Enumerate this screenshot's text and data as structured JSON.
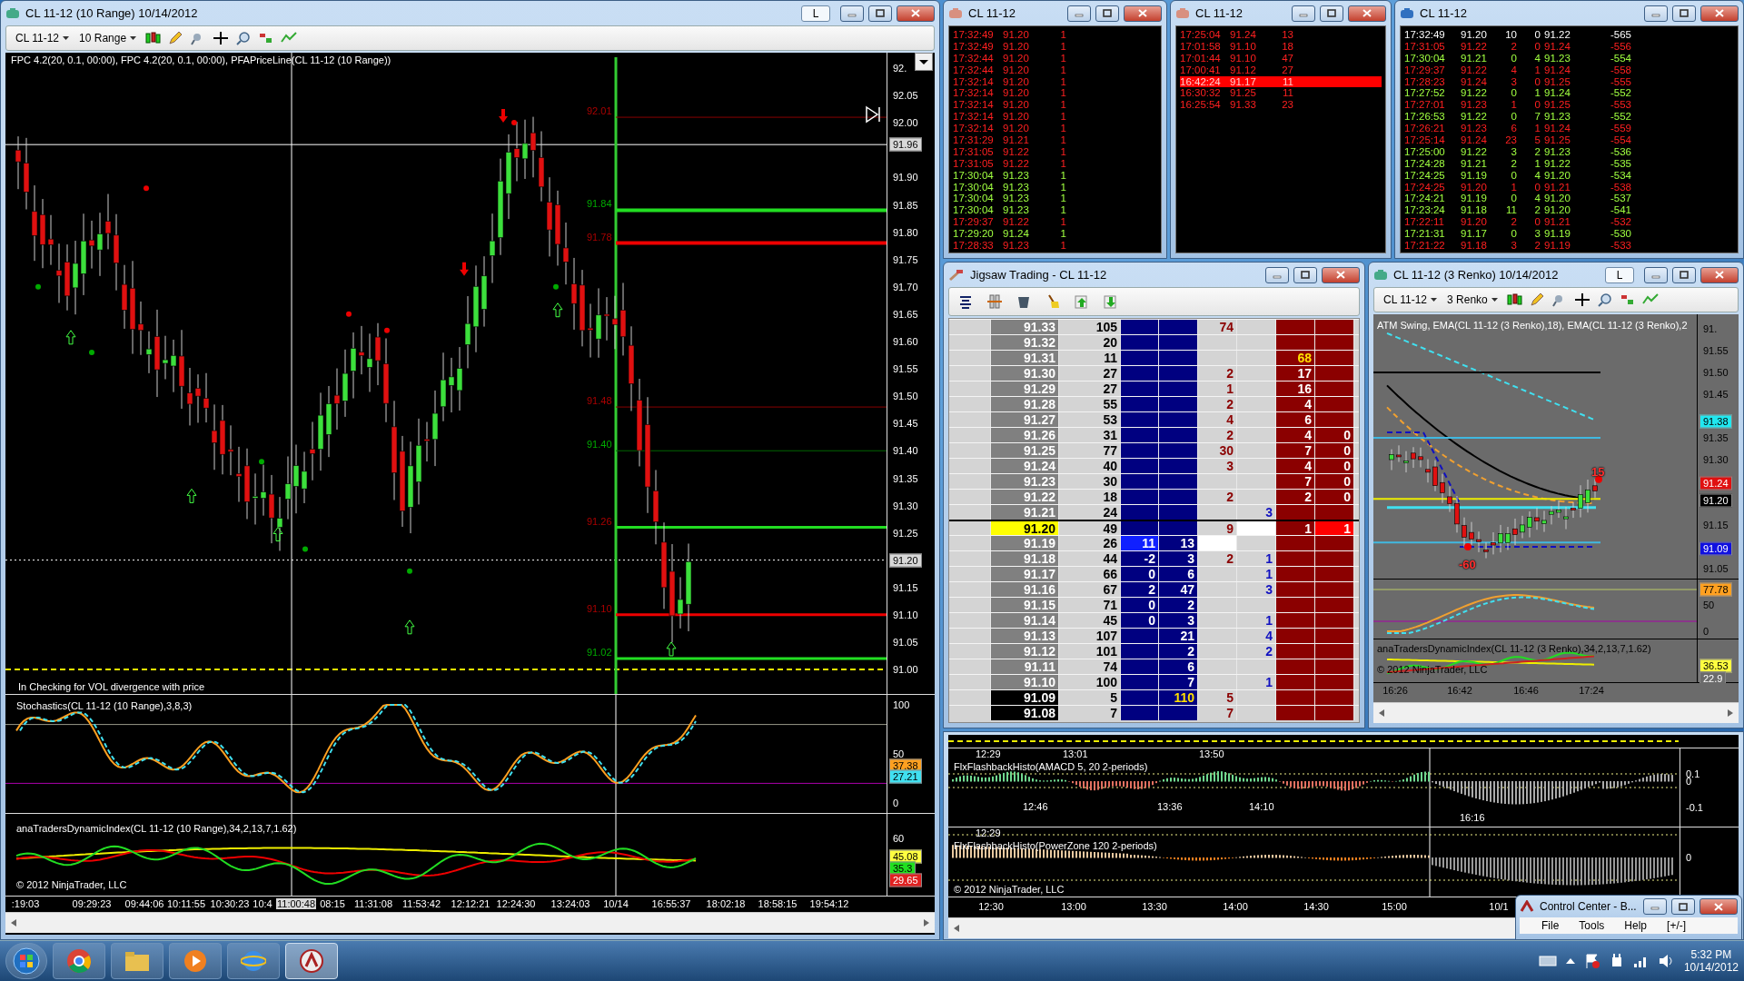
{
  "main_chart": {
    "title": "CL 11-12 (10 Range)  10/14/2012",
    "lock_label": "L",
    "instrument": "CL 11-12",
    "period": "10 Range",
    "indicator_line": "FPC 4.2(20, 0.1, 00:00), FPC 4.2(20, 0.1, 00:00), PFAPriceLine(CL 11-12 (10 Range))",
    "price_axis": [
      "92.",
      "92.05",
      "92.00",
      "91.90",
      "91.85",
      "91.80",
      "91.75",
      "91.70",
      "91.65",
      "91.60",
      "91.55",
      "91.50",
      "91.45",
      "91.40",
      "91.35",
      "91.30",
      "91.25",
      "91.15",
      "91.10",
      "91.05",
      "91.00"
    ],
    "price_badges": [
      {
        "text": "91.96",
        "color": "#d8d8d8"
      },
      {
        "text": "91.20",
        "color": "#d8d8d8"
      }
    ],
    "level_labels": [
      "92.01",
      "91.84",
      "91.78",
      "91.48",
      "91.40",
      "91.26",
      "91.10",
      "91.02"
    ],
    "note": "In  Checking for VOL  divergence with price",
    "stochastics": {
      "title": "Stochastics(CL 11-12 (10 Range),3,8,3)",
      "axis": [
        "100",
        "50",
        "0"
      ],
      "badges": [
        {
          "text": "37.38",
          "color": "#ffa020"
        },
        {
          "text": "27.21",
          "color": "#40e0f0"
        }
      ]
    },
    "dynamic_index": {
      "title": "anaTradersDynamicIndex(CL 11-12 (10 Range),34,2,13,7,1.62)",
      "axis": [
        "60"
      ],
      "badges": [
        {
          "text": "45.08",
          "color": "#ffff40"
        },
        {
          "text": "35.3",
          "color": "#20e020"
        },
        {
          "text": "29.65",
          "color": "#e02020"
        }
      ]
    },
    "copyright": "© 2012 NinjaTrader, LLC",
    "time_axis": [
      {
        "label": ":19:03",
        "kind": "tick"
      },
      {
        "label": "09:29:23",
        "kind": "tick"
      },
      {
        "label": "09:44:06",
        "kind": "tick"
      },
      {
        "label": "10:11:55",
        "kind": "tick"
      },
      {
        "label": "10:30:23",
        "kind": "tick"
      },
      {
        "label": "10:4",
        "kind": "tick"
      },
      {
        "label": "11:00:48",
        "kind": "cursor"
      },
      {
        "label": "08:15",
        "kind": "tick"
      },
      {
        "label": "11:31:08",
        "kind": "tick"
      },
      {
        "label": "11:53:42",
        "kind": "tick"
      },
      {
        "label": "12:12:21",
        "kind": "tick"
      },
      {
        "label": "12:24:30",
        "kind": "tick"
      },
      {
        "label": "13:24:03",
        "kind": "tick"
      },
      {
        "label": "10/14",
        "kind": "tick"
      },
      {
        "label": "16:55:37",
        "kind": "tick"
      },
      {
        "label": "18:02:18",
        "kind": "tick"
      },
      {
        "label": "18:58:15",
        "kind": "tick"
      },
      {
        "label": "19:54:12",
        "kind": "tick"
      }
    ]
  },
  "time_sales": [
    {
      "title": "CL 11-12",
      "rows": [
        {
          "cells": [
            "17:32:49",
            "91.20",
            "1"
          ],
          "kind": "sell"
        },
        {
          "cells": [
            "17:32:49",
            "91.20",
            "1"
          ],
          "kind": "sell"
        },
        {
          "cells": [
            "17:32:44",
            "91.20",
            "1"
          ],
          "kind": "sell"
        },
        {
          "cells": [
            "17:32:44",
            "91.20",
            "1"
          ],
          "kind": "sell"
        },
        {
          "cells": [
            "17:32:14",
            "91.20",
            "1"
          ],
          "kind": "sell"
        },
        {
          "cells": [
            "17:32:14",
            "91.20",
            "1"
          ],
          "kind": "sell"
        },
        {
          "cells": [
            "17:32:14",
            "91.20",
            "1"
          ],
          "kind": "sell"
        },
        {
          "cells": [
            "17:32:14",
            "91.20",
            "1"
          ],
          "kind": "sell"
        },
        {
          "cells": [
            "17:32:14",
            "91.20",
            "1"
          ],
          "kind": "sell"
        },
        {
          "cells": [
            "17:31:29",
            "91.21",
            "1"
          ],
          "kind": "sell"
        },
        {
          "cells": [
            "17:31:05",
            "91.22",
            "1"
          ],
          "kind": "sell"
        },
        {
          "cells": [
            "17:31:05",
            "91.22",
            "1"
          ],
          "kind": "sell"
        },
        {
          "cells": [
            "17:30:04",
            "91.23",
            "1"
          ],
          "kind": "buy"
        },
        {
          "cells": [
            "17:30:04",
            "91.23",
            "1"
          ],
          "kind": "buy"
        },
        {
          "cells": [
            "17:30:04",
            "91.23",
            "1"
          ],
          "kind": "buy"
        },
        {
          "cells": [
            "17:30:04",
            "91.23",
            "1"
          ],
          "kind": "buy"
        },
        {
          "cells": [
            "17:29:37",
            "91.22",
            "1"
          ],
          "kind": "sell"
        },
        {
          "cells": [
            "17:29:20",
            "91.24",
            "1"
          ],
          "kind": "buy"
        },
        {
          "cells": [
            "17:28:33",
            "91.23",
            "1"
          ],
          "kind": "sell"
        }
      ]
    },
    {
      "title": "CL 11-12",
      "rows": [
        {
          "cells": [
            "17:25:04",
            "91.24",
            "13"
          ],
          "kind": "sell",
          "selected": false
        },
        {
          "cells": [
            "17:01:58",
            "91.10",
            "18"
          ],
          "kind": "sell",
          "selected": false
        },
        {
          "cells": [
            "17:01:44",
            "91.10",
            "47"
          ],
          "kind": "sell",
          "selected": false
        },
        {
          "cells": [
            "17:00:41",
            "91.12",
            "27"
          ],
          "kind": "sell",
          "selected": false
        },
        {
          "cells": [
            "16:42:24",
            "91.17",
            "11"
          ],
          "kind": "sell",
          "selected": true
        },
        {
          "cells": [
            "16:30:32",
            "91.25",
            "11"
          ],
          "kind": "sell",
          "selected": false
        },
        {
          "cells": [
            "16:25:54",
            "91.33",
            "23"
          ],
          "kind": "sell",
          "selected": false
        }
      ]
    },
    {
      "title": "CL 11-12",
      "rows": [
        {
          "cells": [
            "17:32:49",
            "91.20",
            "10",
            "0",
            "91.22",
            "-565"
          ],
          "kind": "neutral"
        },
        {
          "cells": [
            "17:31:05",
            "91.22",
            "2",
            "0",
            "91.24",
            "-556"
          ],
          "kind": "sell"
        },
        {
          "cells": [
            "17:30:04",
            "91.21",
            "0",
            "4",
            "91.23",
            "-554"
          ],
          "kind": "buy"
        },
        {
          "cells": [
            "17:29:37",
            "91.22",
            "4",
            "1",
            "91.24",
            "-558"
          ],
          "kind": "sell"
        },
        {
          "cells": [
            "17:28:23",
            "91.24",
            "3",
            "0",
            "91.25",
            "-555"
          ],
          "kind": "sell"
        },
        {
          "cells": [
            "17:27:52",
            "91.22",
            "0",
            "1",
            "91.24",
            "-552"
          ],
          "kind": "buy"
        },
        {
          "cells": [
            "17:27:01",
            "91.23",
            "1",
            "0",
            "91.25",
            "-553"
          ],
          "kind": "sell"
        },
        {
          "cells": [
            "17:26:53",
            "91.22",
            "0",
            "7",
            "91.23",
            "-552"
          ],
          "kind": "buy"
        },
        {
          "cells": [
            "17:26:21",
            "91.23",
            "6",
            "1",
            "91.24",
            "-559"
          ],
          "kind": "sell"
        },
        {
          "cells": [
            "17:25:14",
            "91.24",
            "23",
            "5",
            "91.25",
            "-554"
          ],
          "kind": "sell"
        },
        {
          "cells": [
            "17:25:00",
            "91.22",
            "3",
            "2",
            "91.23",
            "-536"
          ],
          "kind": "buy"
        },
        {
          "cells": [
            "17:24:28",
            "91.21",
            "2",
            "1",
            "91.22",
            "-535"
          ],
          "kind": "buy"
        },
        {
          "cells": [
            "17:24:25",
            "91.19",
            "0",
            "4",
            "91.20",
            "-534"
          ],
          "kind": "buy"
        },
        {
          "cells": [
            "17:24:25",
            "91.20",
            "1",
            "0",
            "91.21",
            "-538"
          ],
          "kind": "sell"
        },
        {
          "cells": [
            "17:24:21",
            "91.19",
            "0",
            "4",
            "91.20",
            "-537"
          ],
          "kind": "buy"
        },
        {
          "cells": [
            "17:23:24",
            "91.18",
            "11",
            "2",
            "91.20",
            "-541"
          ],
          "kind": "buy"
        },
        {
          "cells": [
            "17:22:11",
            "91.20",
            "2",
            "0",
            "91.21",
            "-532"
          ],
          "kind": "sell"
        },
        {
          "cells": [
            "17:21:31",
            "91.17",
            "0",
            "3",
            "91.19",
            "-530"
          ],
          "kind": "buy"
        },
        {
          "cells": [
            "17:21:22",
            "91.18",
            "3",
            "2",
            "91.19",
            "-533"
          ],
          "kind": "sell"
        }
      ]
    }
  ],
  "dom": {
    "title": "Jigsaw Trading - CL 11-12",
    "rows": [
      {
        "price": "91.33",
        "kind": "normal",
        "cells": [
          "105",
          null,
          null,
          "74",
          null,
          null,
          null
        ]
      },
      {
        "price": "91.32",
        "kind": "normal",
        "cells": [
          "20",
          null,
          null,
          null,
          null,
          null,
          null
        ]
      },
      {
        "price": "91.31",
        "kind": "normal",
        "cells": [
          "11",
          null,
          null,
          null,
          null,
          {
            "text": "68",
            "kind": "yellow"
          },
          null
        ]
      },
      {
        "price": "91.30",
        "kind": "normal",
        "cells": [
          "27",
          null,
          null,
          "2",
          null,
          "17",
          null
        ]
      },
      {
        "price": "91.29",
        "kind": "normal",
        "cells": [
          "27",
          null,
          null,
          "1",
          null,
          "16",
          null
        ]
      },
      {
        "price": "91.28",
        "kind": "normal",
        "cells": [
          "55",
          null,
          null,
          "2",
          null,
          "4",
          null
        ]
      },
      {
        "price": "91.27",
        "kind": "normal",
        "cells": [
          "53",
          null,
          null,
          "4",
          null,
          "6",
          null
        ]
      },
      {
        "price": "91.26",
        "kind": "normal",
        "cells": [
          "31",
          null,
          null,
          "2",
          null,
          "4",
          "0"
        ]
      },
      {
        "price": "91.25",
        "kind": "normal",
        "cells": [
          "77",
          null,
          null,
          "30",
          null,
          "7",
          "0"
        ]
      },
      {
        "price": "91.24",
        "kind": "normal",
        "cells": [
          "40",
          null,
          null,
          "3",
          null,
          "4",
          "0"
        ]
      },
      {
        "price": "91.23",
        "kind": "normal",
        "cells": [
          "30",
          null,
          null,
          null,
          null,
          "7",
          "0"
        ]
      },
      {
        "price": "91.22",
        "kind": "normal",
        "cells": [
          "18",
          null,
          null,
          "2",
          null,
          "2",
          "0"
        ]
      },
      {
        "price": "91.21",
        "kind": "normal",
        "cells": [
          "24",
          null,
          null,
          null,
          "3",
          null,
          null
        ]
      },
      {
        "price": "91.20",
        "kind": "last",
        "cells": [
          "49",
          null,
          null,
          "9",
          {
            "kind": "white"
          },
          "1",
          {
            "text": "1",
            "kind": "red"
          }
        ]
      },
      {
        "price": "91.19",
        "kind": "normal",
        "cells": [
          "26",
          {
            "text": "11",
            "kind": "blue"
          },
          "13",
          {
            "kind": "white"
          },
          null,
          null,
          null
        ]
      },
      {
        "price": "91.18",
        "kind": "normal",
        "cells": [
          "44",
          "-2",
          "3",
          "2",
          "1",
          null,
          null
        ]
      },
      {
        "price": "91.17",
        "kind": "normal",
        "cells": [
          "66",
          "0",
          "6",
          null,
          "1",
          null,
          null
        ]
      },
      {
        "price": "91.16",
        "kind": "normal",
        "cells": [
          "67",
          "2",
          "47",
          null,
          "3",
          null,
          null
        ]
      },
      {
        "price": "91.15",
        "kind": "normal",
        "cells": [
          "71",
          "0",
          "2",
          null,
          null,
          null,
          null
        ]
      },
      {
        "price": "91.14",
        "kind": "normal",
        "cells": [
          "45",
          "0",
          "3",
          null,
          "1",
          null,
          null
        ]
      },
      {
        "price": "91.13",
        "kind": "normal",
        "cells": [
          "107",
          null,
          "21",
          null,
          "4",
          null,
          null
        ]
      },
      {
        "price": "91.12",
        "kind": "normal",
        "cells": [
          "101",
          null,
          "2",
          null,
          "2",
          null,
          null
        ]
      },
      {
        "price": "91.11",
        "kind": "normal",
        "cells": [
          "74",
          null,
          "6",
          null,
          null,
          null,
          null
        ]
      },
      {
        "price": "91.10",
        "kind": "normal",
        "cells": [
          "100",
          null,
          "7",
          null,
          "1",
          null,
          null
        ]
      },
      {
        "price": "91.09",
        "kind": "low",
        "cells": [
          "5",
          null,
          {
            "text": "110",
            "kind": "yellow"
          },
          "5",
          null,
          null,
          null
        ]
      },
      {
        "price": "91.08",
        "kind": "low",
        "cells": [
          "7",
          null,
          null,
          "7",
          null,
          null,
          null
        ]
      }
    ]
  },
  "renko_chart": {
    "title": "CL 11-12 (3 Renko)  10/14/2012",
    "lock_label": "L",
    "instrument": "CL 11-12",
    "period": "3 Renko",
    "indicator_line": "ATM Swing, EMA(CL 11-12 (3 Renko),18), EMA(CL 11-12 (3 Renko),2",
    "price_axis": [
      "91.",
      "91.55",
      "91.50",
      "91.45",
      "91.35",
      "91.30",
      "91.15",
      "91.05"
    ],
    "badges": [
      {
        "text": "91.38",
        "color": "#20e8f0"
      },
      {
        "text": "91.24",
        "color": "#e01010"
      },
      {
        "text": "91.20",
        "color": "#000000"
      },
      {
        "text": "91.09",
        "color": "#1010e0"
      }
    ],
    "swing_labels": [
      "15",
      "-60"
    ],
    "stoch_axis": [
      "50",
      "0"
    ],
    "stoch_badges": [
      {
        "text": "77.78",
        "color": "#ffa020"
      }
    ],
    "dyn_title": "anaTradersDynamicIndex(CL 11-12 (3 Renko),34,2,13,7,1.62)",
    "dyn_badges": [
      {
        "text": "36.53",
        "color": "#ffff40"
      },
      {
        "text": "22.9",
        "color": "#6b6b6b"
      }
    ],
    "copyright": "© 2012 NinjaTrader, LLC",
    "time_axis": [
      "16:26",
      "16:42",
      "16:46",
      "17:24"
    ]
  },
  "histo_chart": {
    "panels": [
      {
        "title": "FlxFlashbackHisto(AMACD 5, 20 2-periods)",
        "annotations": [
          "12:29",
          "13:01",
          "13:50",
          "12:46",
          "13:36",
          "14:10",
          "16:16"
        ],
        "axis": [
          "0.1",
          "0",
          "-0.1"
        ]
      },
      {
        "title": "FlxFlashbackHisto(PowerZone 120 2-periods)",
        "annotations": [
          "12:29"
        ],
        "axis": [
          "0"
        ]
      }
    ],
    "copyright": "© 2012 NinjaTrader, LLC",
    "time_axis": [
      "12:30",
      "13:00",
      "13:30",
      "14:00",
      "14:30",
      "15:00",
      "10/1"
    ]
  },
  "control_center": {
    "title": "Control Center - B...",
    "menu": [
      "File",
      "Tools",
      "Help",
      "[+/-]"
    ]
  },
  "taskbar": {
    "time": "5:32 PM",
    "date": "10/14/2012"
  }
}
